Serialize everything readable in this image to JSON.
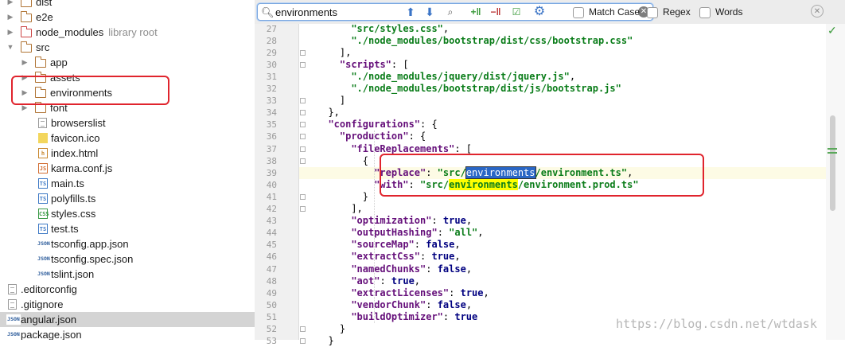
{
  "tree": [
    {
      "label": "dist",
      "hint": "",
      "type": "folder",
      "arrow": "right",
      "depth": 0,
      "folder_color": "normal",
      "selected": false
    },
    {
      "label": "e2e",
      "hint": "",
      "type": "folder",
      "arrow": "right",
      "depth": 0,
      "folder_color": "normal",
      "selected": false
    },
    {
      "label": "node_modules",
      "hint": "library root",
      "type": "folder",
      "arrow": "right",
      "depth": 0,
      "folder_color": "red",
      "selected": false
    },
    {
      "label": "src",
      "hint": "",
      "type": "folder",
      "arrow": "down",
      "depth": 0,
      "folder_color": "normal",
      "selected": false
    },
    {
      "label": "app",
      "hint": "",
      "type": "folder",
      "arrow": "right",
      "depth": 1,
      "folder_color": "normal",
      "selected": false
    },
    {
      "label": "assets",
      "hint": "",
      "type": "folder",
      "arrow": "right",
      "depth": 1,
      "folder_color": "normal",
      "selected": false
    },
    {
      "label": "environments",
      "hint": "",
      "type": "folder",
      "arrow": "right",
      "depth": 1,
      "folder_color": "normal",
      "selected": false
    },
    {
      "label": "font",
      "hint": "",
      "type": "folder",
      "arrow": "right",
      "depth": 1,
      "folder_color": "normal",
      "selected": false
    },
    {
      "label": "browserslist",
      "hint": "",
      "type": "file",
      "badge": "",
      "depth": 2,
      "selected": false
    },
    {
      "label": "favicon.ico",
      "hint": "",
      "type": "ico",
      "badge": "",
      "depth": 2,
      "selected": false
    },
    {
      "label": "index.html",
      "hint": "",
      "type": "html",
      "badge": "h",
      "depth": 2,
      "selected": false
    },
    {
      "label": "karma.conf.js",
      "hint": "",
      "type": "js",
      "badge": "JS",
      "depth": 2,
      "selected": false
    },
    {
      "label": "main.ts",
      "hint": "",
      "type": "ts",
      "badge": "TS",
      "depth": 2,
      "selected": false
    },
    {
      "label": "polyfills.ts",
      "hint": "",
      "type": "ts",
      "badge": "TS",
      "depth": 2,
      "selected": false
    },
    {
      "label": "styles.css",
      "hint": "",
      "type": "css",
      "badge": "CSS",
      "depth": 2,
      "selected": false
    },
    {
      "label": "test.ts",
      "hint": "",
      "type": "ts",
      "badge": "TS",
      "depth": 2,
      "selected": false
    },
    {
      "label": "tsconfig.app.json",
      "hint": "",
      "type": "json",
      "badge": "JSON",
      "depth": 2,
      "selected": false
    },
    {
      "label": "tsconfig.spec.json",
      "hint": "",
      "type": "json",
      "badge": "JSON",
      "depth": 2,
      "selected": false
    },
    {
      "label": "tslint.json",
      "hint": "",
      "type": "json",
      "badge": "JSON",
      "depth": 2,
      "selected": false
    },
    {
      "label": ".editorconfig",
      "hint": "",
      "type": "file",
      "badge": "",
      "depth": 0,
      "selected": false
    },
    {
      "label": ".gitignore",
      "hint": "",
      "type": "file",
      "badge": "",
      "depth": 0,
      "selected": false
    },
    {
      "label": "angular.json",
      "hint": "",
      "type": "json",
      "badge": "JSON",
      "depth": 0,
      "selected": true
    },
    {
      "label": "package.json",
      "hint": "",
      "type": "json",
      "badge": "JSON",
      "depth": 0,
      "selected": false
    }
  ],
  "search": {
    "query": "environments",
    "options": [
      {
        "label": "Match Case",
        "checked": false
      },
      {
        "label": "Regex",
        "checked": false
      },
      {
        "label": "Words",
        "checked": false
      }
    ]
  },
  "editor": {
    "current_line": 39,
    "lines": [
      {
        "n": 27,
        "indent": 6,
        "tokens": [
          [
            "s",
            "\"src/styles.css\""
          ],
          [
            "p",
            ","
          ]
        ]
      },
      {
        "n": 28,
        "indent": 6,
        "tokens": [
          [
            "s",
            "\"./node_modules/bootstrap/dist/css/bootstrap.css\""
          ]
        ]
      },
      {
        "n": 29,
        "indent": 4,
        "tokens": [
          [
            "p",
            "],"
          ]
        ]
      },
      {
        "n": 30,
        "indent": 4,
        "tokens": [
          [
            "k",
            "\"scripts\""
          ],
          [
            "p",
            ": ["
          ]
        ]
      },
      {
        "n": 31,
        "indent": 6,
        "tokens": [
          [
            "s",
            "\"./node_modules/jquery/dist/jquery.js\""
          ],
          [
            "p",
            ","
          ]
        ]
      },
      {
        "n": 32,
        "indent": 6,
        "tokens": [
          [
            "s",
            "\"./node_modules/bootstrap/dist/js/bootstrap.js\""
          ]
        ]
      },
      {
        "n": 33,
        "indent": 4,
        "tokens": [
          [
            "p",
            "]"
          ]
        ]
      },
      {
        "n": 34,
        "indent": 2,
        "tokens": [
          [
            "p",
            "},"
          ]
        ]
      },
      {
        "n": 35,
        "indent": 2,
        "tokens": [
          [
            "k",
            "\"configurations\""
          ],
          [
            "p",
            ": {"
          ]
        ]
      },
      {
        "n": 36,
        "indent": 4,
        "tokens": [
          [
            "k",
            "\"production\""
          ],
          [
            "p",
            ": {"
          ]
        ]
      },
      {
        "n": 37,
        "indent": 6,
        "tokens": [
          [
            "k",
            "\"fileReplacements\""
          ],
          [
            "p",
            ": ["
          ]
        ]
      },
      {
        "n": 38,
        "indent": 8,
        "tokens": [
          [
            "p",
            "{"
          ]
        ]
      },
      {
        "n": 39,
        "indent": 10,
        "tokens": [
          [
            "k",
            "\"replace\""
          ],
          [
            "p",
            ": "
          ],
          [
            "s",
            "\"src/"
          ],
          [
            "hs",
            "environments"
          ],
          [
            "s",
            "/environment.ts\""
          ],
          [
            "p",
            ","
          ]
        ]
      },
      {
        "n": 40,
        "indent": 10,
        "tokens": [
          [
            "k",
            "\"with\""
          ],
          [
            "p",
            ": "
          ],
          [
            "s",
            "\"src/"
          ],
          [
            "h",
            "environments"
          ],
          [
            "s",
            "/environment.prod.ts\""
          ]
        ]
      },
      {
        "n": 41,
        "indent": 8,
        "tokens": [
          [
            "p",
            "}"
          ]
        ]
      },
      {
        "n": 42,
        "indent": 6,
        "tokens": [
          [
            "p",
            "],"
          ]
        ]
      },
      {
        "n": 43,
        "indent": 6,
        "tokens": [
          [
            "k",
            "\"optimization\""
          ],
          [
            "p",
            ": "
          ],
          [
            "kw",
            "true"
          ],
          [
            "p",
            ","
          ]
        ]
      },
      {
        "n": 44,
        "indent": 6,
        "tokens": [
          [
            "k",
            "\"outputHashing\""
          ],
          [
            "p",
            ": "
          ],
          [
            "s",
            "\"all\""
          ],
          [
            "p",
            ","
          ]
        ]
      },
      {
        "n": 45,
        "indent": 6,
        "tokens": [
          [
            "k",
            "\"sourceMap\""
          ],
          [
            "p",
            ": "
          ],
          [
            "kw",
            "false"
          ],
          [
            "p",
            ","
          ]
        ]
      },
      {
        "n": 46,
        "indent": 6,
        "tokens": [
          [
            "k",
            "\"extractCss\""
          ],
          [
            "p",
            ": "
          ],
          [
            "kw",
            "true"
          ],
          [
            "p",
            ","
          ]
        ]
      },
      {
        "n": 47,
        "indent": 6,
        "tokens": [
          [
            "k",
            "\"namedChunks\""
          ],
          [
            "p",
            ": "
          ],
          [
            "kw",
            "false"
          ],
          [
            "p",
            ","
          ]
        ]
      },
      {
        "n": 48,
        "indent": 6,
        "tokens": [
          [
            "k",
            "\"aot\""
          ],
          [
            "p",
            ": "
          ],
          [
            "kw",
            "true"
          ],
          [
            "p",
            ","
          ]
        ]
      },
      {
        "n": 49,
        "indent": 6,
        "tokens": [
          [
            "k",
            "\"extractLicenses\""
          ],
          [
            "p",
            ": "
          ],
          [
            "kw",
            "true"
          ],
          [
            "p",
            ","
          ]
        ]
      },
      {
        "n": 50,
        "indent": 6,
        "tokens": [
          [
            "k",
            "\"vendorChunk\""
          ],
          [
            "p",
            ": "
          ],
          [
            "kw",
            "false"
          ],
          [
            "p",
            ","
          ]
        ]
      },
      {
        "n": 51,
        "indent": 6,
        "tokens": [
          [
            "k",
            "\"buildOptimizer\""
          ],
          [
            "p",
            ": "
          ],
          [
            "kw",
            "true"
          ]
        ]
      },
      {
        "n": 52,
        "indent": 4,
        "tokens": [
          [
            "p",
            "}"
          ]
        ]
      },
      {
        "n": 53,
        "indent": 2,
        "tokens": [
          [
            "p",
            "}"
          ]
        ]
      }
    ]
  },
  "watermark": "https://blog.csdn.net/wtdask",
  "colors": {
    "annotation": "#e0242d",
    "match_highlight": "#ffff00",
    "selected_match": "#2a67c6",
    "json_key": "#650f7a",
    "json_string": "#0b7d1a"
  }
}
